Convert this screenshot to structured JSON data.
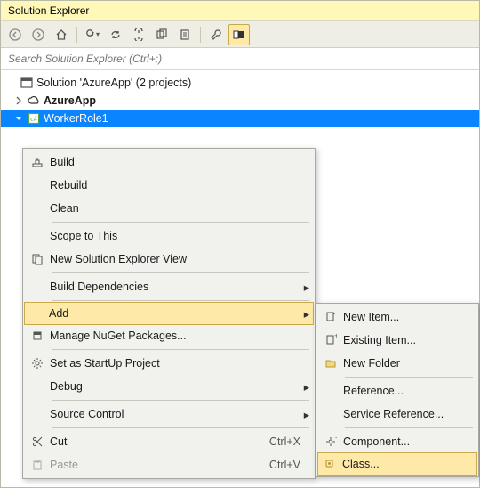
{
  "panel": {
    "title": "Solution Explorer",
    "search_placeholder": "Search Solution Explorer (Ctrl+;)"
  },
  "toolbar": {
    "back": "back-icon",
    "forward": "forward-icon",
    "home": "home-icon",
    "refresh": "refresh-icon",
    "sync": "sync-icon",
    "collapse": "collapse-icon",
    "showall": "showall-icon",
    "copy": "copy-icon",
    "properties": "properties-icon",
    "preview": "preview-icon"
  },
  "tree": {
    "solution_label": "Solution 'AzureApp' (2 projects)",
    "project1": "AzureApp",
    "project2": "WorkerRole1"
  },
  "context_menu": {
    "build": "Build",
    "rebuild": "Rebuild",
    "clean": "Clean",
    "scope": "Scope to This",
    "newview": "New Solution Explorer View",
    "build_deps": "Build Dependencies",
    "add": "Add",
    "nuget": "Manage NuGet Packages...",
    "startup": "Set as StartUp Project",
    "debug": "Debug",
    "source_control": "Source Control",
    "cut": "Cut",
    "cut_key": "Ctrl+X",
    "paste": "Paste",
    "paste_key": "Ctrl+V"
  },
  "submenu": {
    "new_item": "New Item...",
    "existing_item": "Existing Item...",
    "new_folder": "New Folder",
    "reference": "Reference...",
    "service_ref": "Service Reference...",
    "component": "Component...",
    "class": "Class..."
  }
}
